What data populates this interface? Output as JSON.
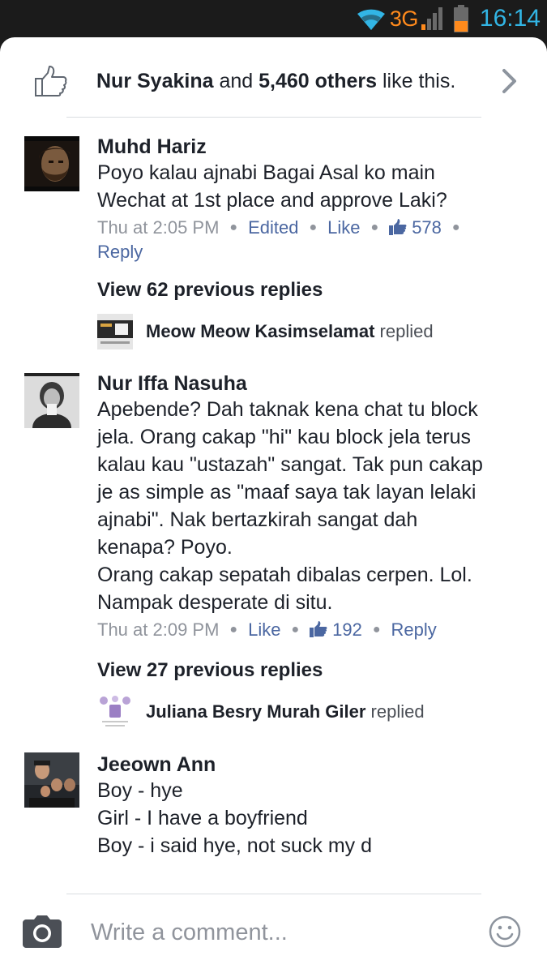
{
  "status_bar": {
    "network": "3G",
    "clock": "16:14",
    "icons": [
      "wifi-icon",
      "signal-icon",
      "battery-icon"
    ]
  },
  "likes": {
    "first_name": "Nur Syakina",
    "connector": " and ",
    "others": "5,460 others",
    "suffix": " like this."
  },
  "comments": [
    {
      "author": "Muhd Hariz",
      "text_lines": [
        "Poyo kalau ajnabi Bagai Asal ko main",
        "Wechat at 1st place and approve Laki?"
      ],
      "time": "Thu at 2:05 PM",
      "edited": "Edited",
      "like": "Like",
      "like_count": "578",
      "reply": "Reply",
      "view_previous": "View 62 previous replies",
      "last_reply_author": "Meow Meow Kasimselamat",
      "last_reply_verb": " replied"
    },
    {
      "author": "Nur Iffa Nasuha",
      "text_lines": [
        "Apebende? Dah taknak kena chat tu block",
        "jela. Orang cakap \"hi\" kau block jela terus",
        "kalau kau \"ustazah\" sangat. Tak pun cakap",
        "je as simple as \"maaf saya tak layan lelaki",
        "ajnabi\". Nak bertazkirah sangat dah",
        "kenapa? Poyo.",
        "Orang cakap sepatah dibalas cerpen. Lol.",
        "Nampak desperate di situ."
      ],
      "time": "Thu at 2:09 PM",
      "like": "Like",
      "like_count": "192",
      "reply": "Reply",
      "view_previous": "View 27 previous replies",
      "last_reply_author": "Juliana Besry Murah Giler",
      "last_reply_verb": " replied"
    },
    {
      "author": "Jeeown Ann",
      "text_lines": [
        "Boy - hye",
        "Girl - I have a boyfriend",
        "Boy - i said hye, not suck my d"
      ]
    }
  ],
  "composer": {
    "placeholder": "Write a comment..."
  },
  "colors": {
    "status_bg": "#1b1b1b",
    "network": "#ff8a1c",
    "clock": "#32b5e5",
    "link": "#4b67a1",
    "text": "#1d2129",
    "meta": "#90949c"
  }
}
